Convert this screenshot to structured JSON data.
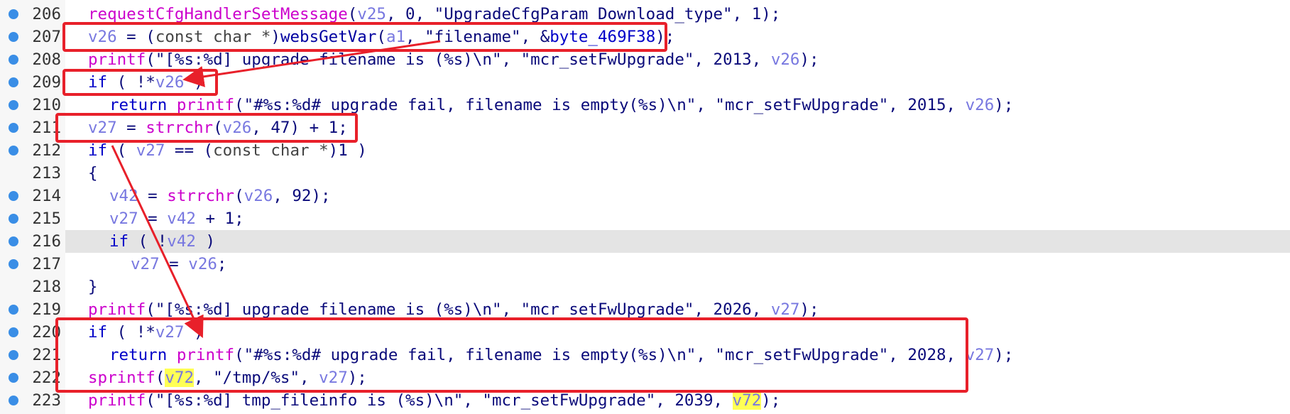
{
  "editor": {
    "lines": [
      {
        "num": "206",
        "bp": true,
        "hl": false,
        "tokens": [
          {
            "t": "requestCfgHandlerSetMessage",
            "c": "fn"
          },
          {
            "t": "(",
            "c": "p"
          },
          {
            "t": "v25",
            "c": "var"
          },
          {
            "t": ", 0, ",
            "c": "p"
          },
          {
            "t": "\"UpgradeCfgParam_Download_type\"",
            "c": "str"
          },
          {
            "t": ", 1);",
            "c": "p"
          }
        ]
      },
      {
        "num": "207",
        "bp": true,
        "hl": false,
        "tokens": [
          {
            "t": "v26",
            "c": "var"
          },
          {
            "t": " = (",
            "c": "p"
          },
          {
            "t": "const char *",
            "c": "type"
          },
          {
            "t": ")",
            "c": "p"
          },
          {
            "t": "websGetVar",
            "c": "fn2"
          },
          {
            "t": "(",
            "c": "p"
          },
          {
            "t": "a1",
            "c": "var"
          },
          {
            "t": ", ",
            "c": "p"
          },
          {
            "t": "\"filename\"",
            "c": "str"
          },
          {
            "t": ", &",
            "c": "p"
          },
          {
            "t": "byte_469F38",
            "c": "glob"
          },
          {
            "t": ");",
            "c": "p"
          }
        ]
      },
      {
        "num": "208",
        "bp": true,
        "hl": false,
        "tokens": [
          {
            "t": "printf",
            "c": "fn"
          },
          {
            "t": "(",
            "c": "p"
          },
          {
            "t": "\"[%s:%d] upgrade filename is (%s)\\n\"",
            "c": "str"
          },
          {
            "t": ", ",
            "c": "p"
          },
          {
            "t": "\"mcr_setFwUpgrade\"",
            "c": "str"
          },
          {
            "t": ", 2013, ",
            "c": "p"
          },
          {
            "t": "v26",
            "c": "var"
          },
          {
            "t": ");",
            "c": "p"
          }
        ]
      },
      {
        "num": "209",
        "bp": true,
        "hl": false,
        "tokens": [
          {
            "t": "if",
            "c": "kw"
          },
          {
            "t": " ( !*",
            "c": "p"
          },
          {
            "t": "v26",
            "c": "var"
          },
          {
            "t": " )",
            "c": "p"
          }
        ]
      },
      {
        "num": "210",
        "bp": true,
        "hl": false,
        "indent": 1,
        "tokens": [
          {
            "t": "return",
            "c": "kw"
          },
          {
            "t": " ",
            "c": "p"
          },
          {
            "t": "printf",
            "c": "fn"
          },
          {
            "t": "(",
            "c": "p"
          },
          {
            "t": "\"#%s:%d# upgrade fail, filename is empty(%s)\\n\"",
            "c": "str"
          },
          {
            "t": ", ",
            "c": "p"
          },
          {
            "t": "\"mcr_setFwUpgrade\"",
            "c": "str"
          },
          {
            "t": ", 2015, ",
            "c": "p"
          },
          {
            "t": "v26",
            "c": "var"
          },
          {
            "t": ");",
            "c": "p"
          }
        ]
      },
      {
        "num": "211",
        "bp": true,
        "hl": false,
        "tokens": [
          {
            "t": "v27",
            "c": "var"
          },
          {
            "t": " = ",
            "c": "p"
          },
          {
            "t": "strrchr",
            "c": "fn"
          },
          {
            "t": "(",
            "c": "p"
          },
          {
            "t": "v26",
            "c": "var"
          },
          {
            "t": ", 47) + 1;",
            "c": "p"
          }
        ]
      },
      {
        "num": "212",
        "bp": true,
        "hl": false,
        "tokens": [
          {
            "t": "if",
            "c": "kw"
          },
          {
            "t": " ( ",
            "c": "p"
          },
          {
            "t": "v27",
            "c": "var"
          },
          {
            "t": " == (",
            "c": "p"
          },
          {
            "t": "const char *",
            "c": "type"
          },
          {
            "t": ")1 )",
            "c": "p"
          }
        ]
      },
      {
        "num": "213",
        "bp": false,
        "hl": false,
        "tokens": [
          {
            "t": "{",
            "c": "p"
          }
        ]
      },
      {
        "num": "214",
        "bp": true,
        "hl": false,
        "indent": 1,
        "tokens": [
          {
            "t": "v42",
            "c": "var"
          },
          {
            "t": " = ",
            "c": "p"
          },
          {
            "t": "strrchr",
            "c": "fn"
          },
          {
            "t": "(",
            "c": "p"
          },
          {
            "t": "v26",
            "c": "var"
          },
          {
            "t": ", 92);",
            "c": "p"
          }
        ]
      },
      {
        "num": "215",
        "bp": true,
        "hl": false,
        "indent": 1,
        "tokens": [
          {
            "t": "v27",
            "c": "var"
          },
          {
            "t": " = ",
            "c": "p"
          },
          {
            "t": "v42",
            "c": "var"
          },
          {
            "t": " + 1;",
            "c": "p"
          }
        ]
      },
      {
        "num": "216",
        "bp": true,
        "hl": true,
        "indent": 1,
        "tokens": [
          {
            "t": "if",
            "c": "kw"
          },
          {
            "t": " ( !",
            "c": "p"
          },
          {
            "t": "v42",
            "c": "var"
          },
          {
            "t": " )",
            "c": "p"
          }
        ]
      },
      {
        "num": "217",
        "bp": true,
        "hl": false,
        "indent": 2,
        "tokens": [
          {
            "t": "v27",
            "c": "var"
          },
          {
            "t": " = ",
            "c": "p"
          },
          {
            "t": "v26",
            "c": "var"
          },
          {
            "t": ";",
            "c": "p"
          }
        ]
      },
      {
        "num": "218",
        "bp": false,
        "hl": false,
        "tokens": [
          {
            "t": "}",
            "c": "p"
          }
        ]
      },
      {
        "num": "219",
        "bp": true,
        "hl": false,
        "tokens": [
          {
            "t": "printf",
            "c": "fn"
          },
          {
            "t": "(",
            "c": "p"
          },
          {
            "t": "\"[%s:%d] upgrade filename is (%s)\\n\"",
            "c": "str"
          },
          {
            "t": ", ",
            "c": "p"
          },
          {
            "t": "\"mcr_setFwUpgrade\"",
            "c": "str"
          },
          {
            "t": ", 2026, ",
            "c": "p"
          },
          {
            "t": "v27",
            "c": "var"
          },
          {
            "t": ");",
            "c": "p"
          }
        ]
      },
      {
        "num": "220",
        "bp": true,
        "hl": false,
        "tokens": [
          {
            "t": "if",
            "c": "kw"
          },
          {
            "t": " ( !*",
            "c": "p"
          },
          {
            "t": "v27",
            "c": "var"
          },
          {
            "t": " )",
            "c": "p"
          }
        ]
      },
      {
        "num": "221",
        "bp": true,
        "hl": false,
        "indent": 1,
        "tokens": [
          {
            "t": "return",
            "c": "kw"
          },
          {
            "t": " ",
            "c": "p"
          },
          {
            "t": "printf",
            "c": "fn"
          },
          {
            "t": "(",
            "c": "p"
          },
          {
            "t": "\"#%s:%d# upgrade fail, filename is empty(%s)\\n\"",
            "c": "str"
          },
          {
            "t": ", ",
            "c": "p"
          },
          {
            "t": "\"mcr_setFwUpgrade\"",
            "c": "str"
          },
          {
            "t": ", 2028, ",
            "c": "p"
          },
          {
            "t": "v27",
            "c": "var"
          },
          {
            "t": ");",
            "c": "p"
          }
        ]
      },
      {
        "num": "222",
        "bp": true,
        "hl": false,
        "tokens": [
          {
            "t": "sprintf",
            "c": "fn"
          },
          {
            "t": "(",
            "c": "p"
          },
          {
            "t": "v72",
            "c": "hl"
          },
          {
            "t": ", ",
            "c": "p"
          },
          {
            "t": "\"/tmp/%s\"",
            "c": "str"
          },
          {
            "t": ", ",
            "c": "p"
          },
          {
            "t": "v27",
            "c": "var"
          },
          {
            "t": ");",
            "c": "p"
          }
        ]
      },
      {
        "num": "223",
        "bp": true,
        "hl": false,
        "tokens": [
          {
            "t": "printf",
            "c": "fn"
          },
          {
            "t": "(",
            "c": "p"
          },
          {
            "t": "\"[%s:%d] tmp_fileinfo is (%s)\\n\"",
            "c": "str"
          },
          {
            "t": ", ",
            "c": "p"
          },
          {
            "t": "\"mcr_setFwUpgrade\"",
            "c": "str"
          },
          {
            "t": ", 2039, ",
            "c": "p"
          },
          {
            "t": "v72",
            "c": "hl"
          },
          {
            "t": ");",
            "c": "p"
          }
        ]
      }
    ]
  },
  "annotations": {
    "box_color": "#e8202a",
    "arrow_color": "#e8202a",
    "boxes": [
      {
        "name": "annotation-box-line-207",
        "from_line": "207",
        "to_line": "207"
      },
      {
        "name": "annotation-box-line-209",
        "from_line": "209",
        "to_line": "209"
      },
      {
        "name": "annotation-box-line-211",
        "from_line": "211",
        "to_line": "211"
      },
      {
        "name": "annotation-box-lines-220-222",
        "from_line": "220",
        "to_line": "222"
      }
    ],
    "arrows": [
      {
        "name": "arrow-207-to-209",
        "from": "filename argument (line 207)",
        "to": "v26 check (line 209)"
      },
      {
        "name": "arrow-211-to-220",
        "from": "v27 assignment (line 211)",
        "to": "v27 check (line 220)"
      }
    ]
  },
  "colors": {
    "background": "#ffffff",
    "gutter": "#f7f7f7",
    "current_line": "#e4e4e4",
    "breakpoint": "#3a8ee6",
    "keyword": "#0000c8",
    "function": "#cc00cc",
    "variable": "#7878e0",
    "string": "#0a0a7a",
    "highlight": "#ffff55"
  }
}
